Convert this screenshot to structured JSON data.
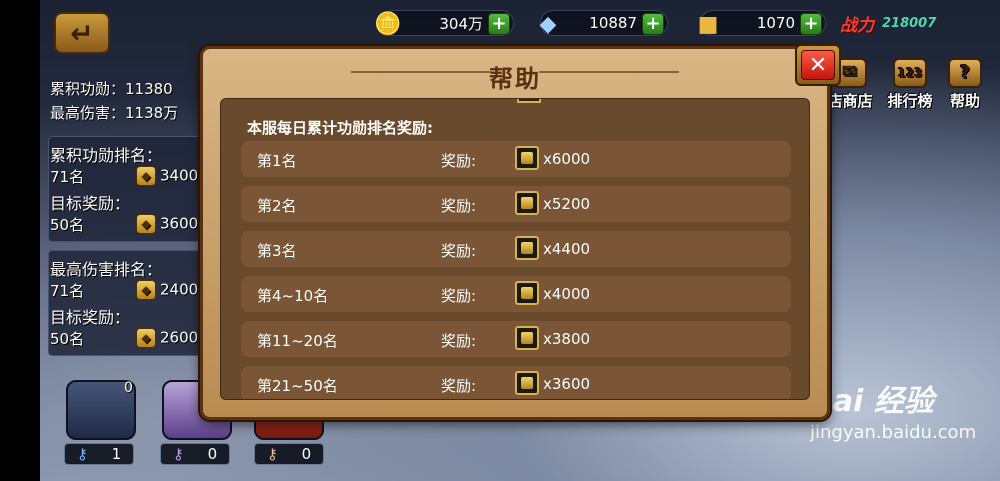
{
  "top_bar": {
    "gold": "304万",
    "diamond": "10887",
    "ticket": "1070",
    "power_label": "战力",
    "power_value": "218007"
  },
  "right_menu": [
    {
      "label": "店商店",
      "glyph": "✉"
    },
    {
      "label": "排行榜",
      "glyph": "123"
    },
    {
      "label": "帮助",
      "glyph": "?"
    }
  ],
  "left_panel": {
    "merit": "累积功勋：11380",
    "max_damage": "最高伤害：1138万",
    "merit_rank_title": "累积功勋排名：",
    "merit_rank": "71名",
    "merit_rank_reward": "3400",
    "merit_target_title": "目标奖励：",
    "merit_target": "50名",
    "merit_target_reward": "3600",
    "damage_rank_title": "最高伤害排名：",
    "damage_rank": "71名",
    "damage_rank_reward": "2400",
    "damage_target_title": "目标奖励：",
    "damage_target": "50名",
    "damage_target_reward": "2600"
  },
  "chests": {
    "count0": "0",
    "key1": "1",
    "key2": "0",
    "key3": "0"
  },
  "dialog": {
    "title": "帮助",
    "close": "✕",
    "section_title": "本服每日累计功勋排名奖励:",
    "reward_label": "奖励:",
    "rows": [
      {
        "rank": "第1名",
        "amount": "x6000"
      },
      {
        "rank": "第2名",
        "amount": "x5200"
      },
      {
        "rank": "第3名",
        "amount": "x4400"
      },
      {
        "rank": "第4~10名",
        "amount": "x4000"
      },
      {
        "rank": "第11~20名",
        "amount": "x3800"
      },
      {
        "rank": "第21~50名",
        "amount": "x3600"
      }
    ]
  },
  "watermark": {
    "logo": "Bai 经验",
    "url": "jingyan.baidu.com"
  }
}
